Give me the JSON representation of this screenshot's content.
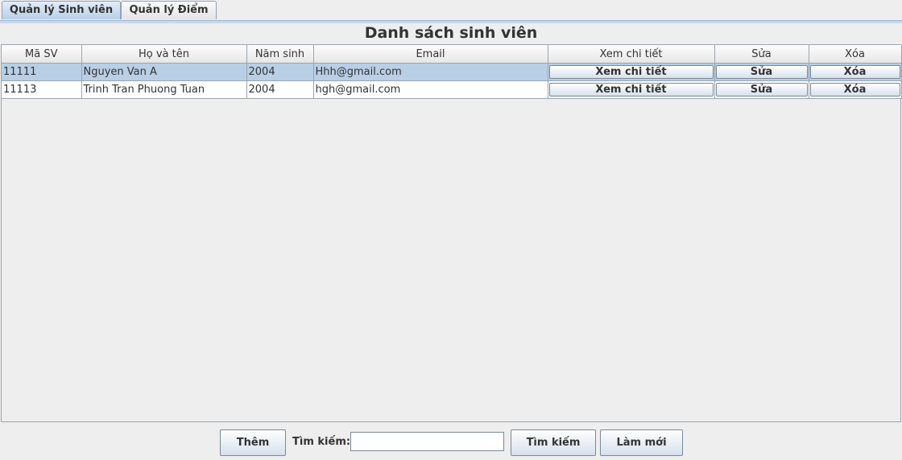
{
  "tabs": [
    {
      "label": "Quản lý Sinh viên",
      "active": true
    },
    {
      "label": "Quản lý Điểm",
      "active": false
    }
  ],
  "title": "Danh sách sinh viên",
  "table": {
    "columns": [
      "Mã SV",
      "Họ và tên",
      "Năm sinh",
      "Email",
      "Xem chi tiết",
      "Sửa",
      "Xóa"
    ],
    "rows": [
      {
        "id": "11111",
        "name": "Nguyen Van A",
        "year": "2004",
        "email": "Hhh@gmail.com",
        "detail": "Xem chi tiết",
        "edit": "Sửa",
        "delete": "Xóa",
        "selected": true
      },
      {
        "id": "11113",
        "name": "Trinh Tran Phuong Tuan",
        "year": "2004",
        "email": "hgh@gmail.com",
        "detail": "Xem chi tiết",
        "edit": "Sửa",
        "delete": "Xóa",
        "selected": false
      }
    ]
  },
  "bottom": {
    "add_label": "Thêm",
    "search_label": "Tìm kiếm:",
    "search_value": "",
    "search_button": "Tìm kiếm",
    "refresh_button": "Làm mới"
  },
  "colors": {
    "selected_row": "#b8cfe5",
    "tab_active": "#b8cfe8"
  }
}
